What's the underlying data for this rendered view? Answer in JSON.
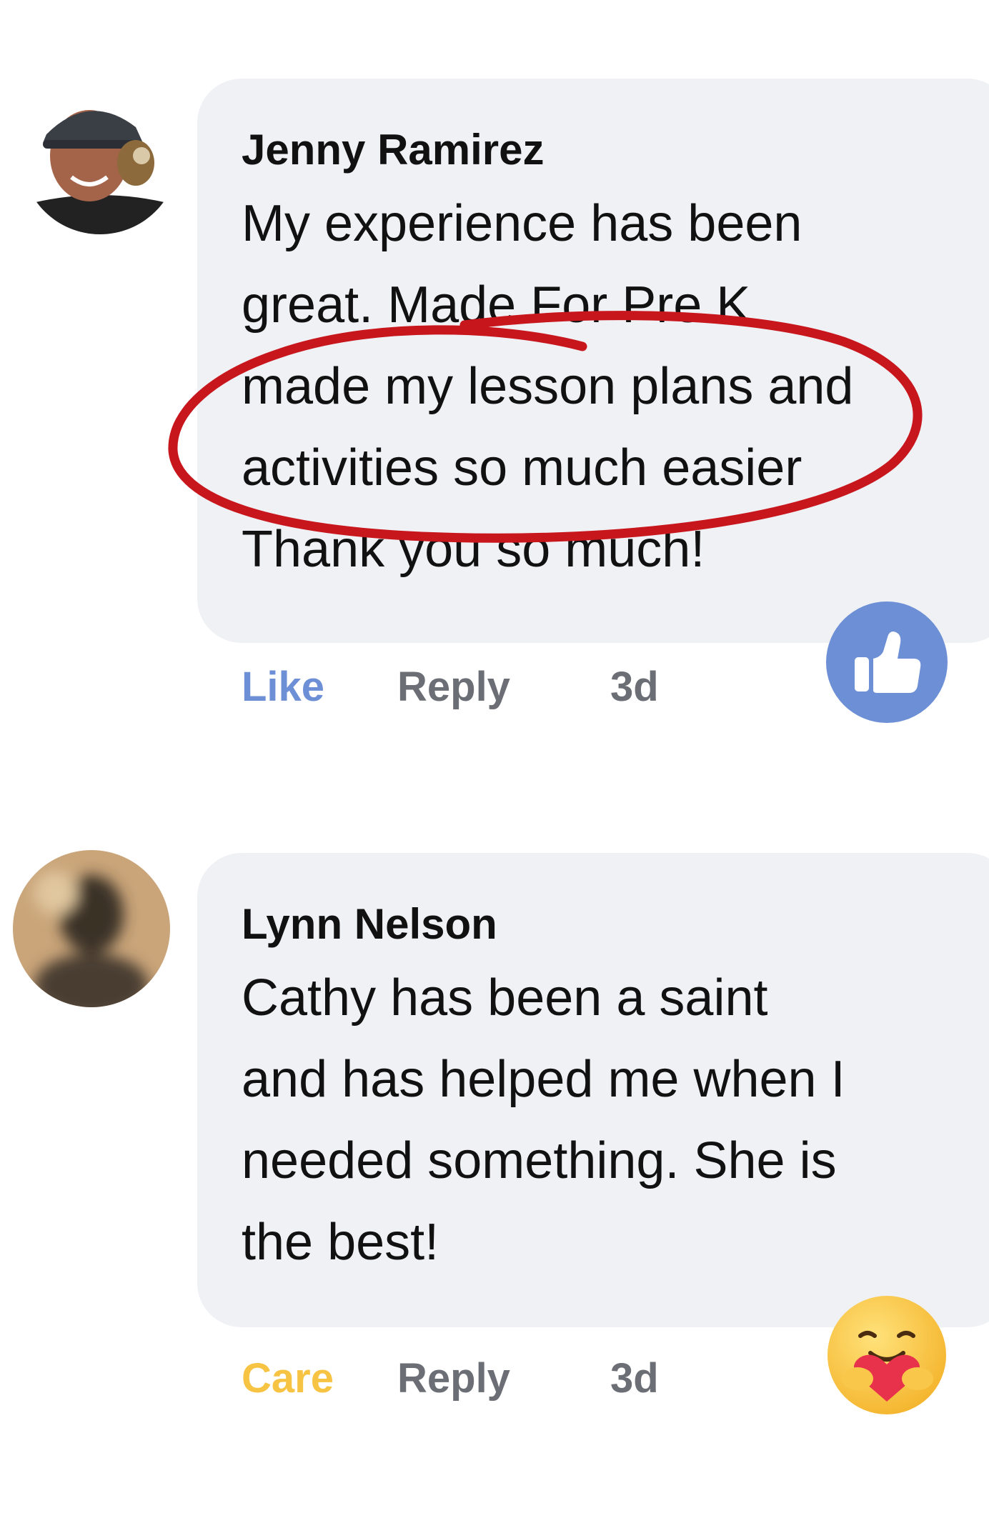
{
  "comments": [
    {
      "author": "Jenny Ramirez",
      "lines": [
        "My experience has been",
        "great. Made For Pre K",
        "made my lesson plans and",
        "activities so much easier",
        "Thank you so much!"
      ],
      "reaction_label": "Like",
      "reply_label": "Reply",
      "time": "3d",
      "reaction_color": "#6d8fd6",
      "reaction_icon": "thumbs-up-icon"
    },
    {
      "author": "Lynn Nelson",
      "lines": [
        "Cathy has been a saint",
        "and has helped me when I",
        "needed something. She is",
        "the best!"
      ],
      "reaction_label": "Care",
      "reply_label": "Reply",
      "time": "3d",
      "reaction_color": "#f6c343",
      "reaction_icon": "care-hug-icon"
    }
  ],
  "annotation": {
    "type": "hand-drawn ellipse",
    "color": "#c8161d"
  }
}
